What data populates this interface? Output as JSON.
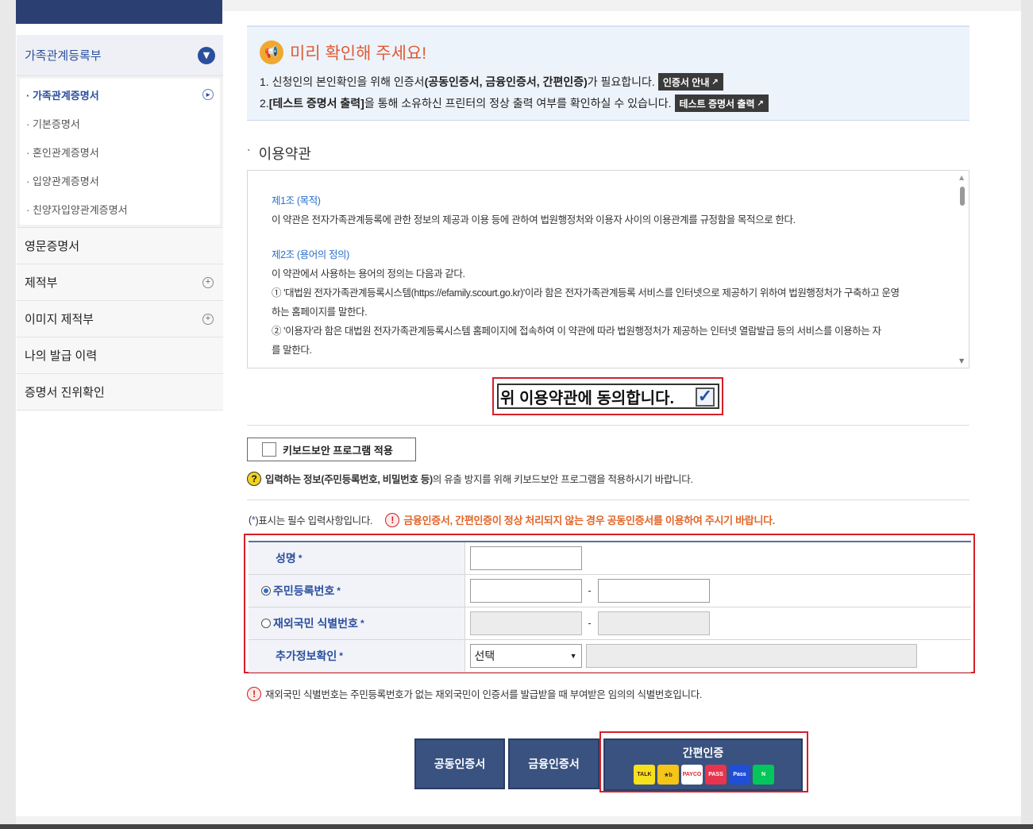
{
  "sidebar": {
    "section_title": "가족관계등록부",
    "sub_items": [
      {
        "label": "가족관계증명서",
        "active": true
      },
      {
        "label": "기본증명서",
        "active": false
      },
      {
        "label": "혼인관계증명서",
        "active": false
      },
      {
        "label": "입양관계증명서",
        "active": false
      },
      {
        "label": "친양자입양관계증명서",
        "active": false
      }
    ],
    "menu": [
      {
        "label": "영문증명서",
        "has_plus": false
      },
      {
        "label": "제적부",
        "has_plus": true
      },
      {
        "label": "이미지 제적부",
        "has_plus": true
      },
      {
        "label": "나의 발급 이력",
        "has_plus": false
      },
      {
        "label": "증명서 진위확인",
        "has_plus": false
      }
    ]
  },
  "notice": {
    "title": "미리 확인해 주세요!",
    "line1_prefix": "1. 신청인의 본인확인을 위해 인증서",
    "line1_bold": "(공동인증서, 금융인증서, 간편인증)",
    "line1_suffix": "가 필요합니다.",
    "line1_button": "인증서 안내",
    "line2_prefix": "2. ",
    "line2_bold": "[테스트 증명서 출력]",
    "line2_suffix": "을 통해 소유하신 프린터의 정상 출력 여부를 확인하실 수 있습니다.",
    "line2_button": "테스트 증명서 출력"
  },
  "terms": {
    "title": "이용약관",
    "art1_title": "제1조 (목적)",
    "art1_text": "이 약관은 전자가족관계등록에 관한 정보의 제공과 이용 등에 관하여 법원행정처와 이용자 사이의 이용관계를 규정함을 목적으로 한다.",
    "art2_title": "제2조 (용어의 정의)",
    "art2_text": "이 약관에서 사용하는 용어의 정의는 다음과 같다.",
    "art2_item1a": "① '대법원 전자가족관계등록시스템(https://efamily.scourt.go.kr)'이라 함은 전자가족관계등록 서비스를 인터넷으로 제공하기 위하여 법원행정처가 구축하고 운영",
    "art2_item1b": "하는 홈페이지를 말한다.",
    "art2_item2a": "② '이용자'라 함은 대법원 전자가족관계등록시스템 홈페이지에 접속하여 이 약관에 따라 법원행정처가 제공하는 인터넷 열람발급 등의 서비스를 이용하는 자",
    "art2_item2b": "를 말한다."
  },
  "agree": {
    "label": "위 이용약관에 동의합니다.",
    "checked": true
  },
  "keyboard": {
    "button": "키보드보안 프로그램 적용",
    "note_bold": "입력하는 정보(주민등록번호, 비밀번호 등)",
    "note_suffix": "의 유출 방지를 위해 키보드보안 프로그램을 적용하시기 바랍니다."
  },
  "required_note": {
    "prefix": "(",
    "star": "*",
    "suffix": ")표시는 필수 입력사항입니다.",
    "warning": "금융인증서, 간편인증이 정상 처리되지 않는 경우 공동인증서를 이용하여 주시기 바랍니다."
  },
  "form": {
    "name_label": "성명",
    "rrn_label": "주민등록번호",
    "rrn_selected": true,
    "foreign_label": "재외국민 식별번호",
    "extra_label": "추가정보확인",
    "star": "*",
    "dash": "-",
    "select_value": "선택"
  },
  "foreign_note": "재외국민 식별번호는 주민등록번호가 없는 재외국민이 인증서를 발급받을 때 부여받은 임의의 식별번호입니다.",
  "buttons": {
    "joint_cert": "공동인증서",
    "financial_cert": "금융인증서",
    "simple_auth": "간편인증"
  },
  "simple_auth_logos": [
    {
      "name": "kakao-icon",
      "text": "TALK",
      "bg": "#f7e01c",
      "fg": "#3a1d1d"
    },
    {
      "name": "kb-icon",
      "text": "★b",
      "bg": "#f5c518",
      "fg": "#333"
    },
    {
      "name": "payco-icon",
      "text": "PAYCO",
      "bg": "#ffffff",
      "fg": "#e3232c"
    },
    {
      "name": "pass-icon",
      "text": "PASS",
      "bg": "#e8344e",
      "fg": "#ffffff"
    },
    {
      "name": "samsung-pass-icon",
      "text": "Pass",
      "bg": "#1f4ed8",
      "fg": "#ffffff"
    },
    {
      "name": "naver-icon",
      "text": "N",
      "bg": "#03c75a",
      "fg": "#ffffff"
    }
  ]
}
